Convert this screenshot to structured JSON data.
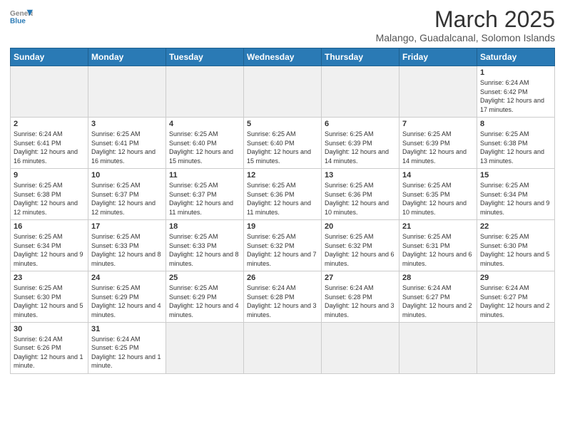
{
  "header": {
    "logo_general": "General",
    "logo_blue": "Blue",
    "month_title": "March 2025",
    "subtitle": "Malango, Guadalcanal, Solomon Islands"
  },
  "weekdays": [
    "Sunday",
    "Monday",
    "Tuesday",
    "Wednesday",
    "Thursday",
    "Friday",
    "Saturday"
  ],
  "days": [
    {
      "num": "",
      "info": "",
      "empty": true
    },
    {
      "num": "",
      "info": "",
      "empty": true
    },
    {
      "num": "",
      "info": "",
      "empty": true
    },
    {
      "num": "",
      "info": "",
      "empty": true
    },
    {
      "num": "",
      "info": "",
      "empty": true
    },
    {
      "num": "",
      "info": "",
      "empty": true
    },
    {
      "num": "1",
      "info": "Sunrise: 6:24 AM\nSunset: 6:42 PM\nDaylight: 12 hours and 17 minutes.",
      "empty": false
    },
    {
      "num": "2",
      "info": "Sunrise: 6:24 AM\nSunset: 6:41 PM\nDaylight: 12 hours and 16 minutes.",
      "empty": false
    },
    {
      "num": "3",
      "info": "Sunrise: 6:25 AM\nSunset: 6:41 PM\nDaylight: 12 hours and 16 minutes.",
      "empty": false
    },
    {
      "num": "4",
      "info": "Sunrise: 6:25 AM\nSunset: 6:40 PM\nDaylight: 12 hours and 15 minutes.",
      "empty": false
    },
    {
      "num": "5",
      "info": "Sunrise: 6:25 AM\nSunset: 6:40 PM\nDaylight: 12 hours and 15 minutes.",
      "empty": false
    },
    {
      "num": "6",
      "info": "Sunrise: 6:25 AM\nSunset: 6:39 PM\nDaylight: 12 hours and 14 minutes.",
      "empty": false
    },
    {
      "num": "7",
      "info": "Sunrise: 6:25 AM\nSunset: 6:39 PM\nDaylight: 12 hours and 14 minutes.",
      "empty": false
    },
    {
      "num": "8",
      "info": "Sunrise: 6:25 AM\nSunset: 6:38 PM\nDaylight: 12 hours and 13 minutes.",
      "empty": false
    },
    {
      "num": "9",
      "info": "Sunrise: 6:25 AM\nSunset: 6:38 PM\nDaylight: 12 hours and 12 minutes.",
      "empty": false
    },
    {
      "num": "10",
      "info": "Sunrise: 6:25 AM\nSunset: 6:37 PM\nDaylight: 12 hours and 12 minutes.",
      "empty": false
    },
    {
      "num": "11",
      "info": "Sunrise: 6:25 AM\nSunset: 6:37 PM\nDaylight: 12 hours and 11 minutes.",
      "empty": false
    },
    {
      "num": "12",
      "info": "Sunrise: 6:25 AM\nSunset: 6:36 PM\nDaylight: 12 hours and 11 minutes.",
      "empty": false
    },
    {
      "num": "13",
      "info": "Sunrise: 6:25 AM\nSunset: 6:36 PM\nDaylight: 12 hours and 10 minutes.",
      "empty": false
    },
    {
      "num": "14",
      "info": "Sunrise: 6:25 AM\nSunset: 6:35 PM\nDaylight: 12 hours and 10 minutes.",
      "empty": false
    },
    {
      "num": "15",
      "info": "Sunrise: 6:25 AM\nSunset: 6:34 PM\nDaylight: 12 hours and 9 minutes.",
      "empty": false
    },
    {
      "num": "16",
      "info": "Sunrise: 6:25 AM\nSunset: 6:34 PM\nDaylight: 12 hours and 9 minutes.",
      "empty": false
    },
    {
      "num": "17",
      "info": "Sunrise: 6:25 AM\nSunset: 6:33 PM\nDaylight: 12 hours and 8 minutes.",
      "empty": false
    },
    {
      "num": "18",
      "info": "Sunrise: 6:25 AM\nSunset: 6:33 PM\nDaylight: 12 hours and 8 minutes.",
      "empty": false
    },
    {
      "num": "19",
      "info": "Sunrise: 6:25 AM\nSunset: 6:32 PM\nDaylight: 12 hours and 7 minutes.",
      "empty": false
    },
    {
      "num": "20",
      "info": "Sunrise: 6:25 AM\nSunset: 6:32 PM\nDaylight: 12 hours and 6 minutes.",
      "empty": false
    },
    {
      "num": "21",
      "info": "Sunrise: 6:25 AM\nSunset: 6:31 PM\nDaylight: 12 hours and 6 minutes.",
      "empty": false
    },
    {
      "num": "22",
      "info": "Sunrise: 6:25 AM\nSunset: 6:30 PM\nDaylight: 12 hours and 5 minutes.",
      "empty": false
    },
    {
      "num": "23",
      "info": "Sunrise: 6:25 AM\nSunset: 6:30 PM\nDaylight: 12 hours and 5 minutes.",
      "empty": false
    },
    {
      "num": "24",
      "info": "Sunrise: 6:25 AM\nSunset: 6:29 PM\nDaylight: 12 hours and 4 minutes.",
      "empty": false
    },
    {
      "num": "25",
      "info": "Sunrise: 6:25 AM\nSunset: 6:29 PM\nDaylight: 12 hours and 4 minutes.",
      "empty": false
    },
    {
      "num": "26",
      "info": "Sunrise: 6:24 AM\nSunset: 6:28 PM\nDaylight: 12 hours and 3 minutes.",
      "empty": false
    },
    {
      "num": "27",
      "info": "Sunrise: 6:24 AM\nSunset: 6:28 PM\nDaylight: 12 hours and 3 minutes.",
      "empty": false
    },
    {
      "num": "28",
      "info": "Sunrise: 6:24 AM\nSunset: 6:27 PM\nDaylight: 12 hours and 2 minutes.",
      "empty": false
    },
    {
      "num": "29",
      "info": "Sunrise: 6:24 AM\nSunset: 6:27 PM\nDaylight: 12 hours and 2 minutes.",
      "empty": false
    },
    {
      "num": "30",
      "info": "Sunrise: 6:24 AM\nSunset: 6:26 PM\nDaylight: 12 hours and 1 minute.",
      "empty": false
    },
    {
      "num": "31",
      "info": "Sunrise: 6:24 AM\nSunset: 6:25 PM\nDaylight: 12 hours and 1 minute.",
      "empty": false
    },
    {
      "num": "",
      "info": "",
      "empty": true
    },
    {
      "num": "",
      "info": "",
      "empty": true
    },
    {
      "num": "",
      "info": "",
      "empty": true
    },
    {
      "num": "",
      "info": "",
      "empty": true
    },
    {
      "num": "",
      "info": "",
      "empty": true
    }
  ]
}
